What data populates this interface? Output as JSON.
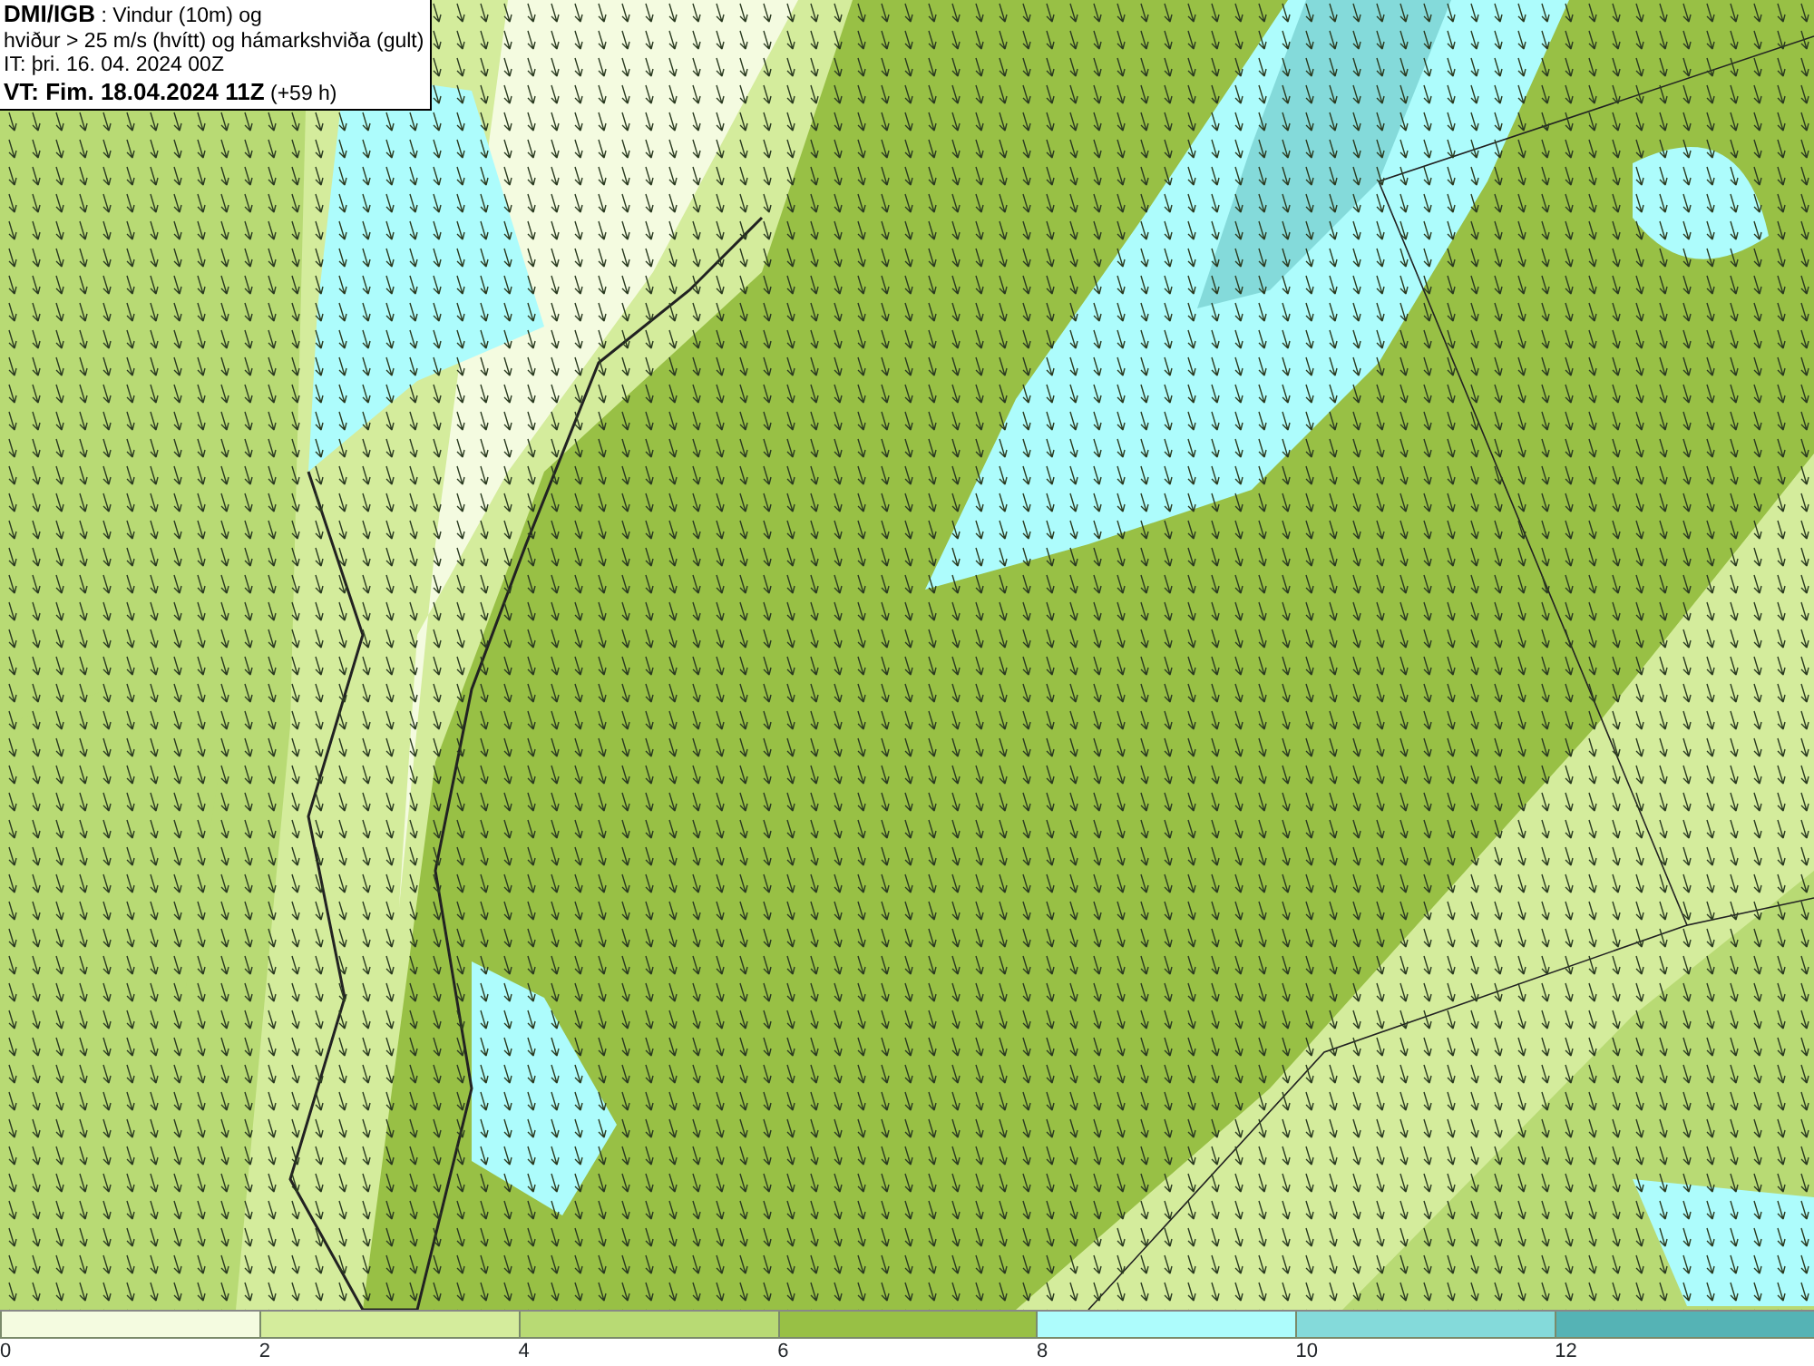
{
  "title_box": {
    "lines": [
      "**DMI/IGB** : Vindur (10m) og",
      "hviður > 25 m/s (hvítt) og hámarkshviða (gult)",
      "IT: þri. 16. 04. 2024 00Z",
      "**VT: Fim. 18.04.2024 11Z** (+59 h)"
    ]
  },
  "legend": [
    {
      "label": "0",
      "color": "#f4fbe0"
    },
    {
      "label": "2",
      "color": "#d4ec9c"
    },
    {
      "label": "4",
      "color": "#b8da74"
    },
    {
      "label": "6",
      "color": "#98c045"
    },
    {
      "label": "8",
      "color": "#adfcfc"
    },
    {
      "label": "10",
      "color": "#84dada"
    },
    {
      "label": "12",
      "color": "#55b3b5"
    }
  ]
}
